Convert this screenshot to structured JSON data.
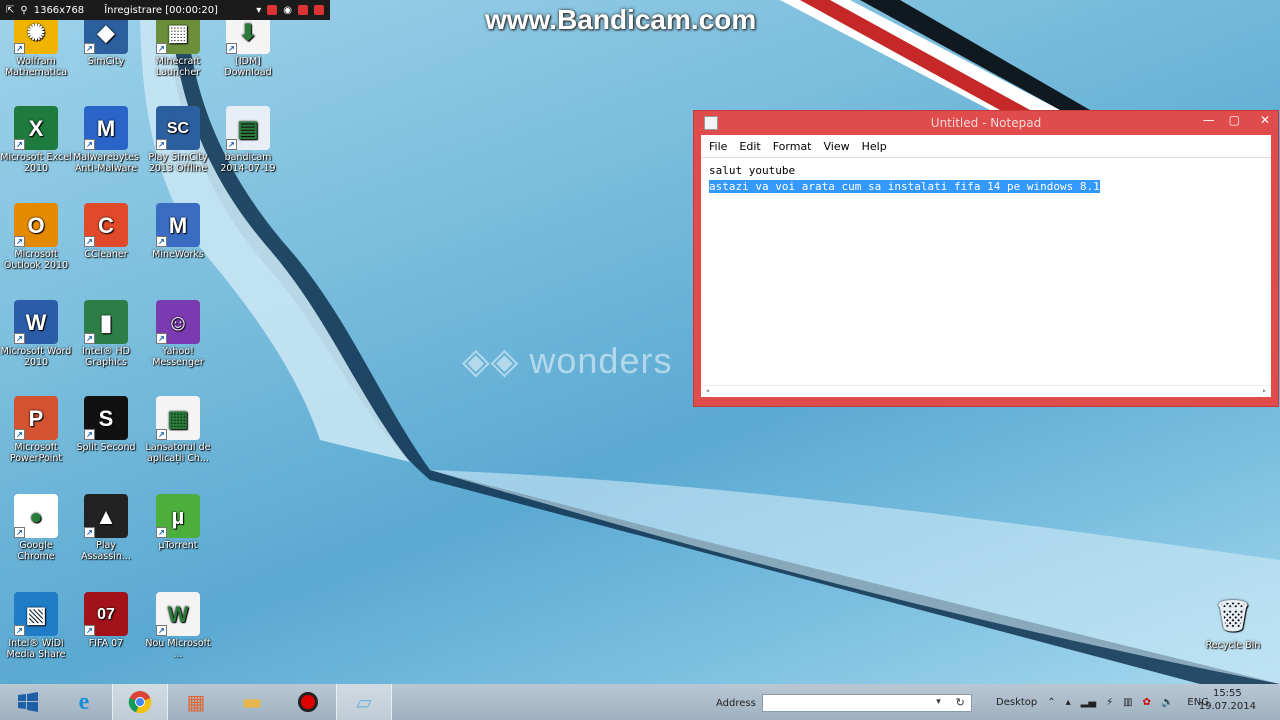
{
  "recorder_bar": {
    "resolution": "1366x768",
    "status": "Înregistrare [00:00:20]"
  },
  "watermarks": {
    "bandicam": "www.Bandicam.com",
    "wondershare": "wonders"
  },
  "desktop_icons": [
    {
      "label": "Wolfram Mathematica",
      "color": "#f0b400",
      "glyph": "✺"
    },
    {
      "label": "SimCity",
      "color": "#2b5f9e",
      "glyph": "◆"
    },
    {
      "label": "Minecraft Launcher",
      "color": "#6b8e3a",
      "glyph": "▦"
    },
    {
      "label": "[IDM] Download",
      "color": "#f4f4f4",
      "glyph": "⬇"
    },
    {
      "label": "Microsoft Excel 2010",
      "color": "#1f7a3e",
      "glyph": "X"
    },
    {
      "label": "Malwarebytes Anti-Malware",
      "color": "#2a64c8",
      "glyph": "M"
    },
    {
      "label": "Play SimCity 2013 Offline",
      "color": "#2c5fa0",
      "glyph": "SC"
    },
    {
      "label": "bandicam 2014-07-19",
      "color": "#e8eef5",
      "glyph": "▤"
    },
    {
      "label": "Microsoft Outlook 2010",
      "color": "#e58a00",
      "glyph": "O"
    },
    {
      "label": "CCleaner",
      "color": "#e04a2a",
      "glyph": "C"
    },
    {
      "label": "MineWorks",
      "color": "#3a6cc2",
      "glyph": "M"
    },
    {
      "label": "Microsoft Word 2010",
      "color": "#2b5ca8",
      "glyph": "W"
    },
    {
      "label": "Intel® HD Graphics",
      "color": "#2c7d46",
      "glyph": "▮"
    },
    {
      "label": "Yahoo! Messenger",
      "color": "#7a3bb0",
      "glyph": "☺"
    },
    {
      "label": "Microsoft PowerPoint",
      "color": "#d35230",
      "glyph": "P"
    },
    {
      "label": "Split Second",
      "color": "#111111",
      "glyph": "S"
    },
    {
      "label": "Lansatorul de aplicații Ch...",
      "color": "#f4f4f4",
      "glyph": "▦"
    },
    {
      "label": "Google Chrome",
      "color": "#ffffff",
      "glyph": "●"
    },
    {
      "label": "Play Assassin...",
      "color": "#222222",
      "glyph": "▲"
    },
    {
      "label": "µTorrent",
      "color": "#4caf3c",
      "glyph": "µ"
    },
    {
      "label": "Intel® WiDi Media Share",
      "color": "#1f7dc8",
      "glyph": "▧"
    },
    {
      "label": "FIFA 07",
      "color": "#a3121a",
      "glyph": "07"
    },
    {
      "label": "Nou Microsoft ...",
      "color": "#f4f4f4",
      "glyph": "W"
    }
  ],
  "recycle_bin": {
    "label": "Recycle Bin"
  },
  "notepad": {
    "title": "Untitled - Notepad",
    "menu": [
      "File",
      "Edit",
      "Format",
      "View",
      "Help"
    ],
    "line1": "salut youtube",
    "line2": "astazi va voi arata cum sa instalati fifa 14 pe windows 8.1",
    "controls": {
      "minimize": "—",
      "maximize": "▢",
      "close": "✕"
    }
  },
  "taskbar": {
    "address_label": "Address",
    "desktop_label": "Desktop",
    "lang": "ENG",
    "time": "15:55",
    "date": "19.07.2014"
  },
  "colors": {
    "notepad_frame": "#e04b4b",
    "selection": "#3399ff",
    "taskbar": "#a9bac8"
  }
}
